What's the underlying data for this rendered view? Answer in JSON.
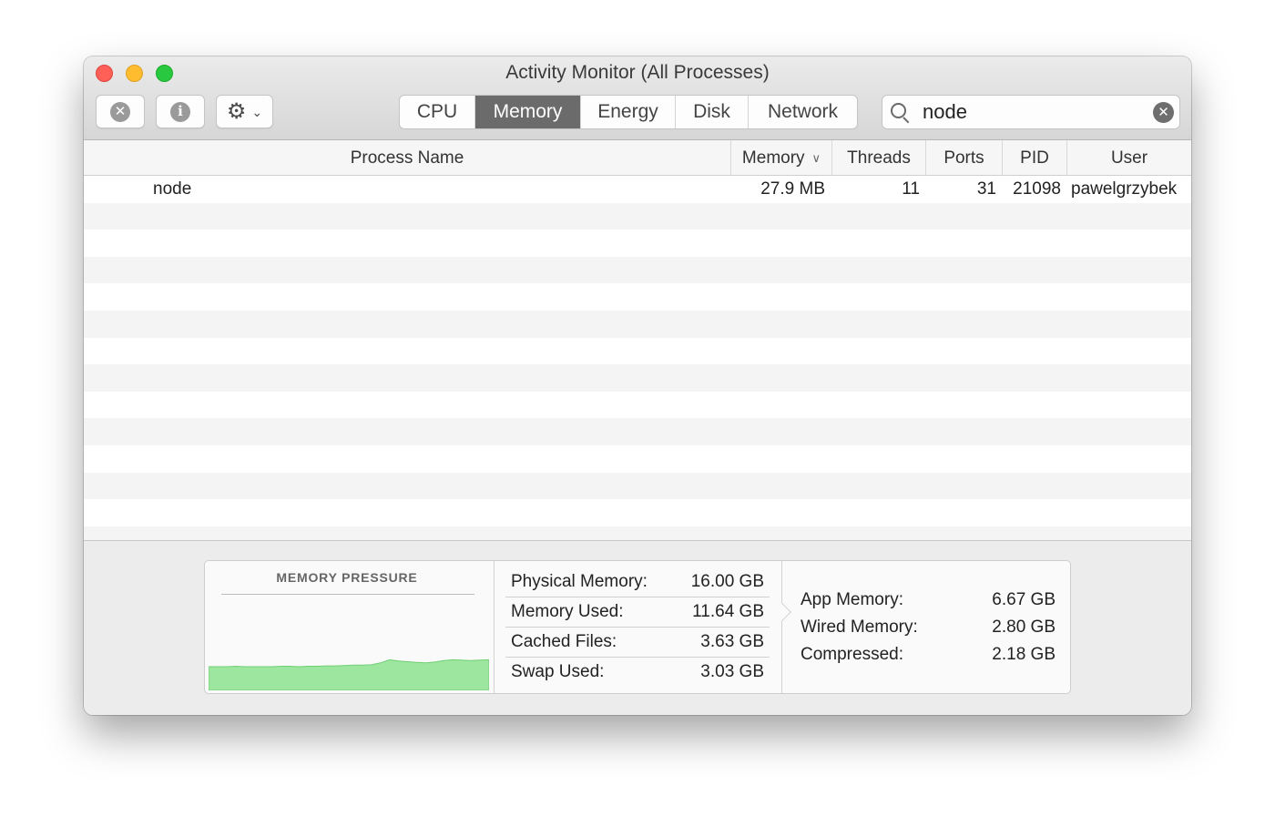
{
  "window": {
    "title": "Activity Monitor (All Processes)"
  },
  "toolbar": {
    "buttons": [
      {
        "name": "stop-process",
        "icon": "close-circle-icon"
      },
      {
        "name": "info",
        "icon": "info-icon"
      },
      {
        "name": "actions",
        "icon": "gear-icon"
      }
    ],
    "tabs": [
      "CPU",
      "Memory",
      "Energy",
      "Disk",
      "Network"
    ],
    "active_tab": "Memory",
    "search": {
      "value": "node",
      "icon": "search-icon"
    }
  },
  "table": {
    "headers": {
      "process_name": "Process Name",
      "memory": "Memory",
      "threads": "Threads",
      "ports": "Ports",
      "pid": "PID",
      "user": "User"
    },
    "sorted_by": "Memory",
    "rows": [
      {
        "process_name": "node",
        "memory": "27.9 MB",
        "threads": "11",
        "ports": "31",
        "pid": "21098",
        "user": "pawelgrzybek"
      }
    ]
  },
  "memory_panel": {
    "pressure_title": "MEMORY PRESSURE",
    "pressure_color": "#9de69f",
    "pressure_samples": [
      0.62,
      0.62,
      0.62,
      0.63,
      0.62,
      0.62,
      0.62,
      0.62,
      0.63,
      0.63,
      0.62,
      0.63,
      0.63,
      0.64,
      0.64,
      0.65,
      0.66,
      0.66,
      0.67,
      0.72,
      0.8,
      0.77,
      0.75,
      0.73,
      0.72,
      0.74,
      0.78,
      0.8,
      0.79,
      0.78,
      0.79,
      0.8
    ],
    "physical_memory": {
      "label": "Physical Memory:",
      "value": "16.00 GB"
    },
    "memory_used": {
      "label": "Memory Used:",
      "value": "11.64 GB"
    },
    "cached_files": {
      "label": "Cached Files:",
      "value": "3.63 GB"
    },
    "swap_used": {
      "label": "Swap Used:",
      "value": "3.03 GB"
    },
    "app_memory": {
      "label": "App Memory:",
      "value": "6.67 GB"
    },
    "wired_memory": {
      "label": "Wired Memory:",
      "value": "2.80 GB"
    },
    "compressed": {
      "label": "Compressed:",
      "value": "2.18 GB"
    }
  }
}
